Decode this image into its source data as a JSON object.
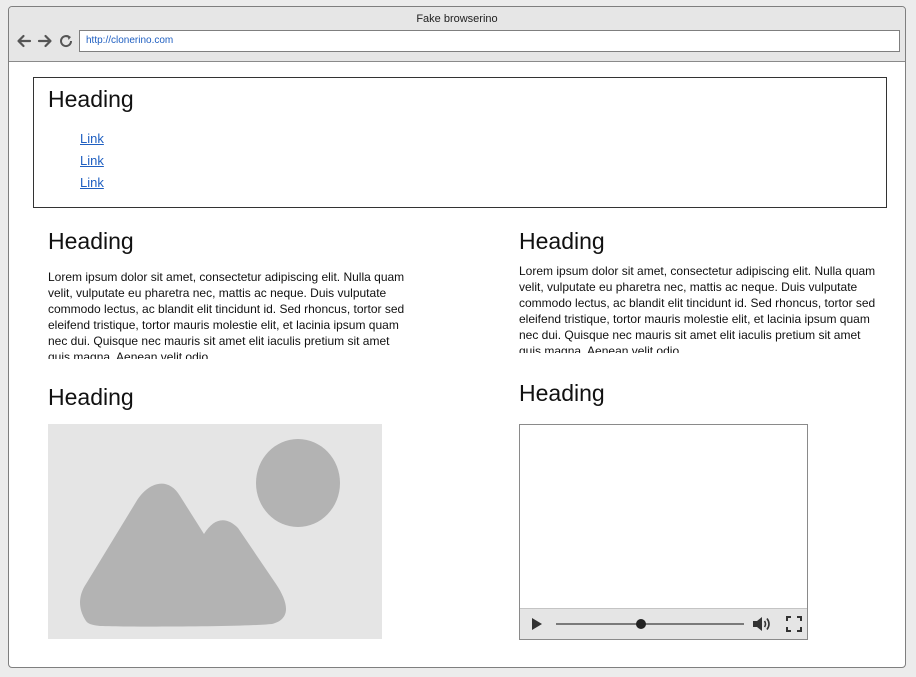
{
  "browser": {
    "title": "Fake browserino",
    "url": "http://clonerino.com"
  },
  "header": {
    "heading": "Heading",
    "links": [
      "Link",
      "Link",
      "Link"
    ]
  },
  "sections": {
    "text_left": {
      "heading": "Heading",
      "body": "Lorem ipsum dolor sit amet, consectetur adipiscing elit. Nulla quam velit, vulputate eu pharetra nec, mattis ac neque. Duis vulputate commodo lectus, ac blandit elit tincidunt id. Sed rhoncus, tortor sed eleifend tristique, tortor mauris molestie elit, et lacinia ipsum quam nec dui. Quisque nec mauris sit amet elit iaculis pretium sit amet quis magna. Aenean velit odio"
    },
    "text_right": {
      "heading": "Heading",
      "body": "Lorem ipsum dolor sit amet, consectetur adipiscing elit. Nulla quam velit, vulputate eu pharetra nec, mattis ac neque. Duis vulputate commodo lectus, ac blandit elit tincidunt id. Sed rhoncus, tortor sed eleifend tristique, tortor mauris molestie elit, et lacinia ipsum quam nec dui. Quisque nec mauris sit amet elit iaculis pretium sit amet quis magna. Aenean velit odio"
    },
    "image": {
      "heading": "Heading",
      "icon": "image-placeholder-icon"
    },
    "video": {
      "heading": "Heading",
      "progress": 0.45
    }
  },
  "colors": {
    "link": "#1f5fc1",
    "placeholder": "#e5e5e5",
    "placeholder_shape": "#b3b3b3"
  }
}
